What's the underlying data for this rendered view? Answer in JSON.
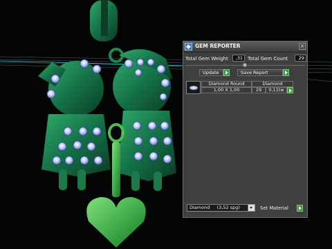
{
  "viewport": {
    "background_color": "#030504",
    "model_color": "#1f8a50",
    "gem_color": "#9db5ff",
    "pendant_color": "#4ebf55"
  },
  "panel": {
    "title": "GEM REPORTER",
    "close_glyph": "×",
    "icon": "gem-reporter-app-icon",
    "stats": {
      "weight_label": "Total Gem Weight",
      "weight_value": ",31",
      "count_label": "Total Gem Count",
      "count_value": "29"
    },
    "buttons": {
      "update_label": "Update",
      "save_report_label": "Save Report"
    },
    "table": {
      "header_col1": "Diamond Round",
      "header_col2": "Diamond",
      "row_size": "1,00 X 1,00",
      "row_count": "29",
      "row_weight": "0,11tw"
    },
    "material": {
      "selected": "Diamond     (3,52 spg)",
      "set_label": "Set Material"
    },
    "accent_color": "#2f9a2f"
  }
}
